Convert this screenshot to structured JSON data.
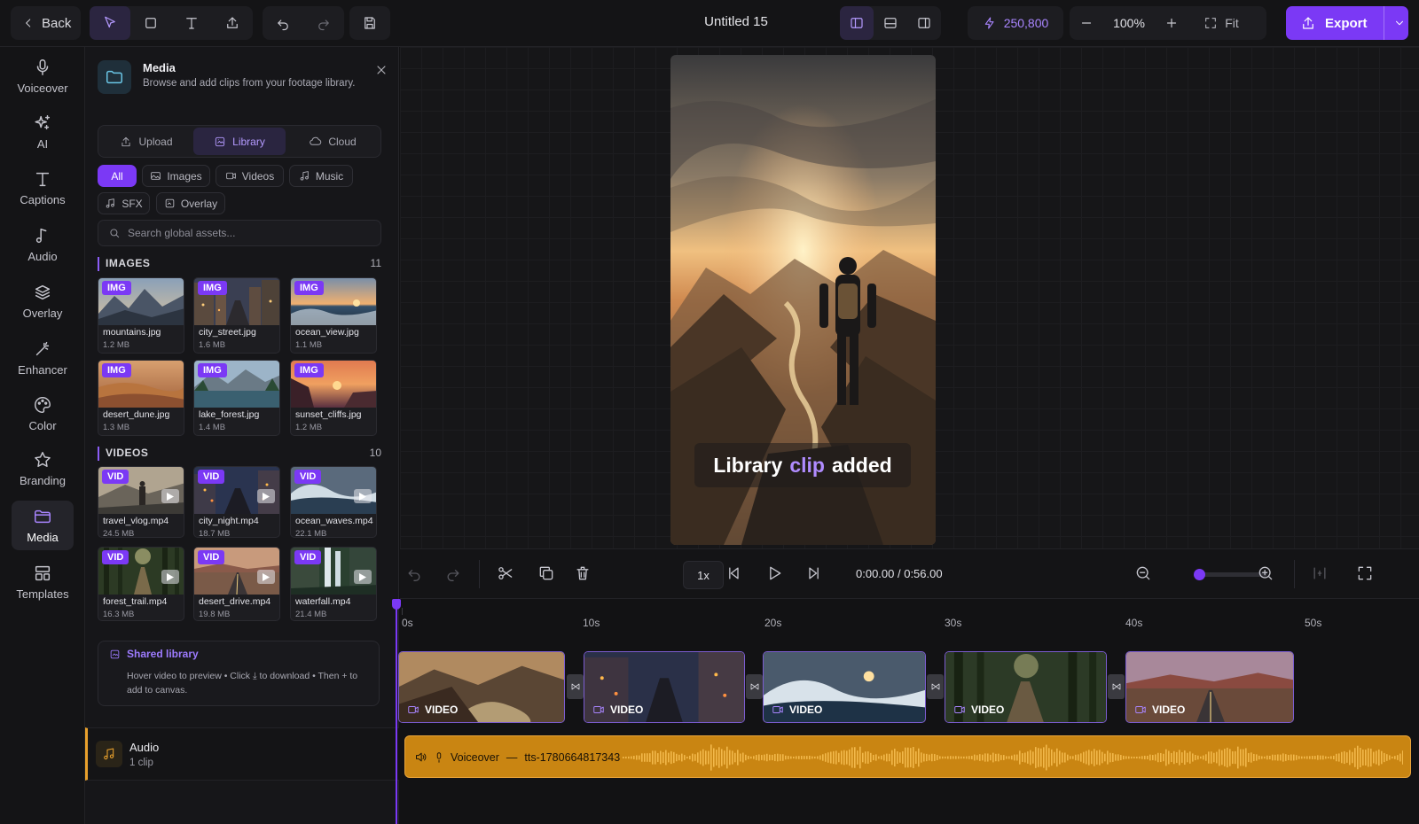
{
  "header": {
    "back_label": "Back",
    "project_title": "Untitled 15",
    "credits": "250,800",
    "zoom": "100%",
    "fit_label": "Fit",
    "export_label": "Export"
  },
  "rail": {
    "items": [
      {
        "label": "Voiceover",
        "icon": "mic-icon"
      },
      {
        "label": "AI",
        "icon": "sparkle-icon"
      },
      {
        "label": "Captions",
        "icon": "text-icon"
      },
      {
        "label": "Audio",
        "icon": "music-note-icon"
      },
      {
        "label": "Overlay",
        "icon": "layers-icon"
      },
      {
        "label": "Enhancer",
        "icon": "magic-wand-icon"
      },
      {
        "label": "Color",
        "icon": "palette-icon"
      },
      {
        "label": "Branding",
        "icon": "star-icon"
      },
      {
        "label": "Media",
        "icon": "folder-icon",
        "active": true
      },
      {
        "label": "Templates",
        "icon": "templates-icon"
      }
    ]
  },
  "panel": {
    "title": "Media",
    "description": "Browse and add clips from your footage library.",
    "tabs": [
      "Upload",
      "Library",
      "Cloud"
    ],
    "active_tab": "Library",
    "filters": [
      "All",
      "Images",
      "Videos",
      "Music",
      "SFX",
      "Overlay"
    ],
    "active_filter": "All",
    "search_placeholder": "Search global assets...",
    "images_section": {
      "title": "IMAGES",
      "count": "11"
    },
    "images": [
      {
        "badge": "IMG",
        "name": "mountains.jpg",
        "size": "1.2 MB"
      },
      {
        "badge": "IMG",
        "name": "city_street.jpg",
        "size": "1.6 MB"
      },
      {
        "badge": "IMG",
        "name": "ocean_view.jpg",
        "size": "1.1 MB"
      },
      {
        "badge": "IMG",
        "name": "desert_dune.jpg",
        "size": "1.3 MB"
      },
      {
        "badge": "IMG",
        "name": "lake_forest.jpg",
        "size": "1.4 MB"
      },
      {
        "badge": "IMG",
        "name": "sunset_cliffs.jpg",
        "size": "1.2 MB"
      }
    ],
    "videos_section": {
      "title": "VIDEOS",
      "count": "10"
    },
    "videos": [
      {
        "badge": "VID",
        "name": "travel_vlog.mp4",
        "size": "24.5 MB"
      },
      {
        "badge": "VID",
        "name": "city_night.mp4",
        "size": "18.7 MB"
      },
      {
        "badge": "VID",
        "name": "ocean_waves.mp4",
        "size": "22.1 MB"
      },
      {
        "badge": "VID",
        "name": "forest_trail.mp4",
        "size": "16.3 MB"
      },
      {
        "badge": "VID",
        "name": "desert_drive.mp4",
        "size": "19.8 MB"
      },
      {
        "badge": "VID",
        "name": "waterfall.mp4",
        "size": "21.4 MB"
      }
    ],
    "shared": {
      "title": "Shared library",
      "description": "Hover video to preview • Click ⤓ to download • Then + to add to canvas."
    },
    "audio_row": {
      "title": "Audio",
      "subtitle": "1 clip"
    }
  },
  "preview": {
    "caption_pre": "Library",
    "caption_highlight": "clip",
    "caption_post": "added"
  },
  "transport": {
    "speed": "1x",
    "timecode": "0:00.00 / 0:56.00",
    "zoom_level": 0.0
  },
  "timeline": {
    "ticks": [
      "0s",
      "10s",
      "20s",
      "30s",
      "40s",
      "50s"
    ],
    "clips": [
      "VIDEO",
      "VIDEO",
      "VIDEO",
      "VIDEO",
      "VIDEO"
    ],
    "audio_track": {
      "label": "Voiceover",
      "separator": "—",
      "file": "tts-1780664817343"
    }
  },
  "colors": {
    "accent": "#7b39f5",
    "audio": "#c98512",
    "media_icon": "#6bc8e8"
  }
}
